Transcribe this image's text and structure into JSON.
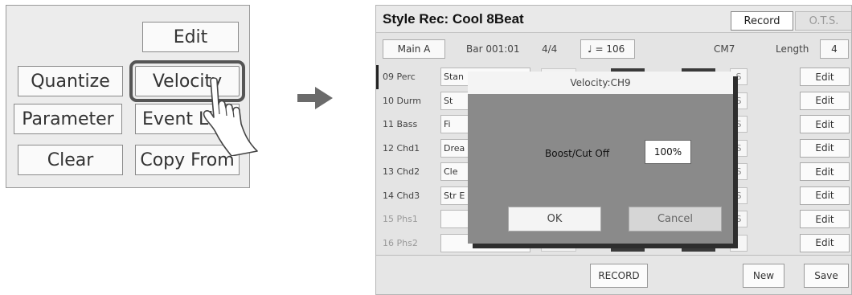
{
  "left_panel": {
    "buttons": {
      "edit": "Edit",
      "quantize": "Quantize",
      "velocity": "Velocity",
      "parameter": "Parameter",
      "event_list": "Event Li",
      "clear": "Clear",
      "copy_from": "Copy From"
    }
  },
  "screen": {
    "title": "Style Rec: Cool 8Beat",
    "tabs": {
      "record": "Record",
      "ots": "O.T.S."
    },
    "info": {
      "section": "Main A",
      "bar": "Bar 001:01",
      "time_sig": "4/4",
      "tempo": "♩ = 106",
      "chord": "CM7",
      "length_label": "Length",
      "length_value": "4"
    },
    "tracks": [
      {
        "name": "09 Perc",
        "voice": "Stan",
        "s": "S",
        "edit": "Edit"
      },
      {
        "name": "10 Durm",
        "voice": "St",
        "s": "S",
        "edit": "Edit"
      },
      {
        "name": "11 Bass",
        "voice": "Fi",
        "s": "S",
        "edit": "Edit"
      },
      {
        "name": "12 Chd1",
        "voice": "Drea",
        "s": "S",
        "edit": "Edit"
      },
      {
        "name": "13 Chd2",
        "voice": "Cle",
        "s": "S",
        "edit": "Edit"
      },
      {
        "name": "14 Chd3",
        "voice": "Str E",
        "s": "S",
        "edit": "Edit"
      },
      {
        "name": "15 Phs1",
        "voice": "",
        "s": "S",
        "edit": "Edit"
      },
      {
        "name": "16 Phs2",
        "voice": "",
        "s": "",
        "edit": "Edit"
      }
    ],
    "bottom": {
      "record": "RECORD",
      "new": "New",
      "save": "Save"
    },
    "dialog": {
      "title": "Velocity:CH9",
      "label": "Boost/Cut Off",
      "value": "100%",
      "ok": "OK",
      "cancel": "Cancel"
    }
  },
  "icons": {
    "arrow": "arrow-right-icon",
    "hand": "pointing-hand-icon"
  },
  "colors": {
    "highlight": "#555555",
    "dialog_bg": "#8a8a8a",
    "arrow": "#6b6b6b"
  }
}
